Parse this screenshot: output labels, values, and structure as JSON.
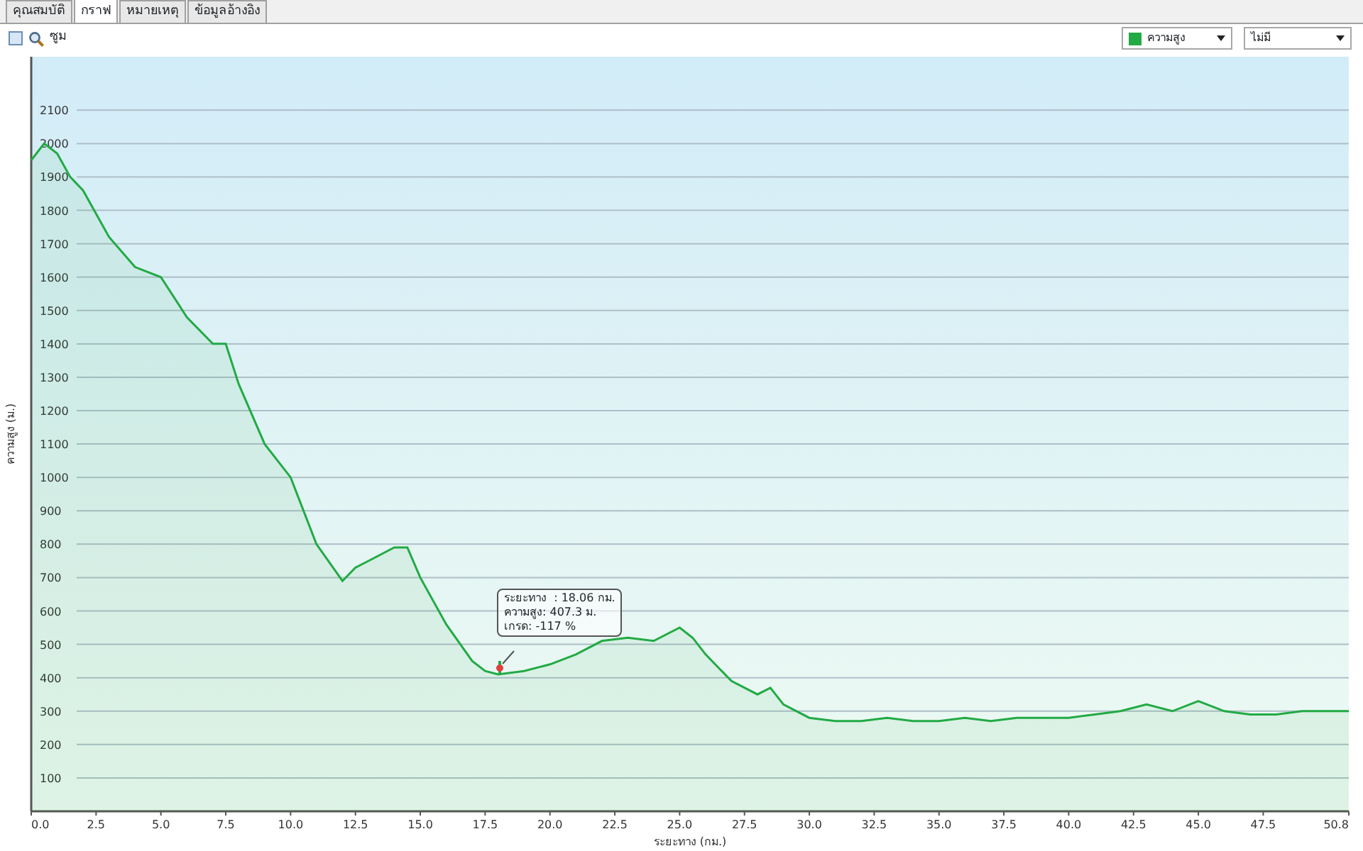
{
  "tabs": [
    {
      "label": "คุณสมบัติ",
      "selected": false
    },
    {
      "label": "กราฟ",
      "selected": true
    },
    {
      "label": "หมายเหตุ",
      "selected": false
    },
    {
      "label": "ข้อมูลอ้างอิง",
      "selected": false
    }
  ],
  "toolbar": {
    "zoom": {
      "label": "ซูม",
      "checked": false
    },
    "compare_select": {
      "value": "ไม่มี"
    }
  },
  "tooltip": {
    "lines": [
      "ระยะทาง  : 18.06 กม.",
      "ความสูง: 407.3 ม.",
      "เกรด: -117 %"
    ]
  },
  "chart_data": {
    "type": "area",
    "grid": true,
    "xlabel": "ระยะทาง  (กม.)",
    "ylabel": "ความสูง (ม.)",
    "xlim": [
      0,
      50.8
    ],
    "ylim": [
      0,
      2260
    ],
    "xticks": [
      {
        "value": 0,
        "label": "0.0"
      },
      {
        "value": 2.5,
        "label": "2.5"
      },
      {
        "value": 5,
        "label": "5.0"
      },
      {
        "value": 7.5,
        "label": "7.5"
      },
      {
        "value": 10,
        "label": "10.0"
      },
      {
        "value": 12.5,
        "label": "12.5"
      },
      {
        "value": 15,
        "label": "15.0"
      },
      {
        "value": 17.5,
        "label": "17.5"
      },
      {
        "value": 20,
        "label": "20.0"
      },
      {
        "value": 22.5,
        "label": "22.5"
      },
      {
        "value": 25,
        "label": "25.0"
      },
      {
        "value": 27.5,
        "label": "27.5"
      },
      {
        "value": 30,
        "label": "30.0"
      },
      {
        "value": 32.5,
        "label": "32.5"
      },
      {
        "value": 35,
        "label": "35.0"
      },
      {
        "value": 37.5,
        "label": "37.5"
      },
      {
        "value": 40,
        "label": "40.0"
      },
      {
        "value": 42.5,
        "label": "42.5"
      },
      {
        "value": 45,
        "label": "45.0"
      },
      {
        "value": 47.5,
        "label": "47.5"
      },
      {
        "value": 50.8,
        "label": "50.8"
      }
    ],
    "yticks": [
      100,
      200,
      300,
      400,
      500,
      600,
      700,
      800,
      900,
      1000,
      1100,
      1200,
      1300,
      1400,
      1500,
      1600,
      1700,
      1800,
      1900,
      2000,
      2100
    ],
    "x": [
      0,
      0.5,
      1,
      1.5,
      2,
      3,
      4,
      5,
      6,
      7,
      7.5,
      8,
      9,
      10,
      11,
      12,
      12.5,
      13,
      14,
      14.5,
      15,
      16,
      17,
      17.5,
      18,
      19,
      20,
      21,
      22,
      23,
      24,
      25,
      25.5,
      26,
      27,
      28,
      28.5,
      29,
      30,
      31,
      32,
      33,
      34,
      35,
      36,
      37,
      38,
      39,
      40,
      41,
      42,
      43,
      44,
      45,
      46,
      47,
      48,
      49,
      50,
      50.8
    ],
    "series": [
      {
        "name": "ความสูง",
        "color": "#22aa44",
        "values": [
          1950,
          2000,
          1970,
          1900,
          1860,
          1720,
          1630,
          1600,
          1480,
          1400,
          1400,
          1280,
          1100,
          1000,
          800,
          690,
          730,
          750,
          790,
          790,
          700,
          560,
          450,
          420,
          410,
          420,
          440,
          470,
          510,
          520,
          510,
          550,
          520,
          470,
          390,
          350,
          370,
          320,
          280,
          270,
          270,
          280,
          270,
          270,
          280,
          270,
          280,
          280,
          280,
          290,
          300,
          320,
          300,
          330,
          300,
          290,
          290,
          300,
          300,
          300
        ]
      }
    ]
  }
}
